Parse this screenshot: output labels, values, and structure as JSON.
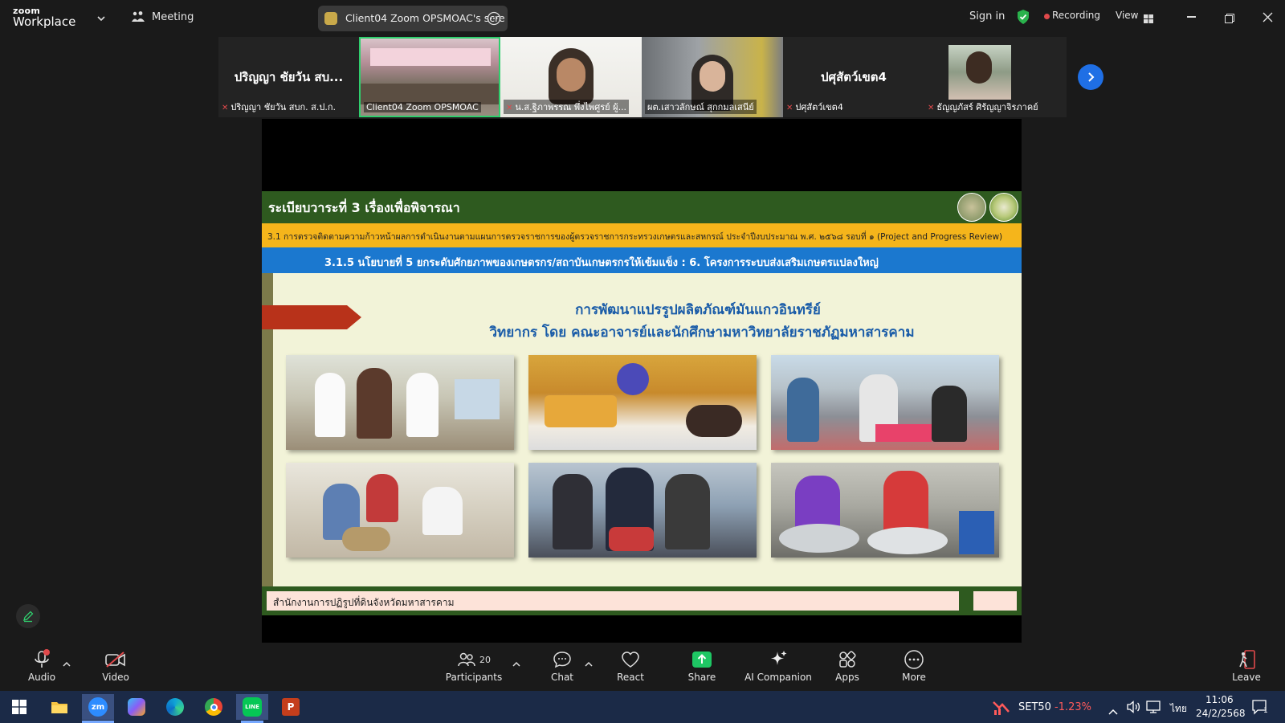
{
  "app": {
    "logo_top": "zoom",
    "logo_bottom": "Workplace",
    "meeting_label": "Meeting",
    "share_title": "Client04 Zoom OPSMOAC's scre",
    "sign_in": "Sign in",
    "recording": "Recording",
    "view": "View"
  },
  "participants_strip": [
    {
      "big_name": "ปริญญา ชัยวัน สบ...",
      "label": "ปริญญา ชัยวัน สบก. ส.ป.ก."
    },
    {
      "big_name": "",
      "label": "Client04 Zoom OPSMOAC"
    },
    {
      "big_name": "",
      "label": "น.ส.ฐิภาพรรณ พึ่งไพศูรย์ ผู้..."
    },
    {
      "big_name": "",
      "label": "ผต.เสาวลักษณ์ สุกกมลเสนีย์"
    },
    {
      "big_name": "ปศุสัตว์เขต4",
      "label": "ปศุสัตว์เขต4"
    },
    {
      "big_name": "",
      "label": "ธัญญภัสร์ ศิรัญญาจิรภาคย์"
    }
  ],
  "slide": {
    "title": "ระเบียบวาระที่ 3 เรื่องเพื่อพิจารณา",
    "yellow_bar": "3.1 การตรวจติดตามความก้าวหน้าผลการดำเนินงานตามแผนการตรวจราชการของผู้ตรวจราชการกระทรวงเกษตรและสหกรณ์ ประจำปีงบประมาณ พ.ศ. ๒๕๖๘ รอบที่ ๑ (Project and Progress Review)",
    "blue_bar": "3.1.5 นโยบายที่ 5 ยกระดับศักยภาพของเกษตรกร/สถาบันเกษตรกรให้เข้มแข็ง : 6. โครงการระบบส่งเสริมเกษตรแปลงใหญ่",
    "heading1": "การพัฒนาแปรรูปผลิตภัณฑ์มันแกวอินทรีย์",
    "heading2": "วิทยากร โดย คณะอาจารย์และนักศึกษามหาวิทยาลัยราชภัฏมหาสารคาม",
    "footer": "สำนักงานการปฏิรูปที่ดินจังหวัดมหาสารคาม"
  },
  "toolbar": {
    "audio": "Audio",
    "video": "Video",
    "participants": "Participants",
    "participants_count": "20",
    "chat": "Chat",
    "react": "React",
    "share": "Share",
    "ai_companion": "AI Companion",
    "apps": "Apps",
    "more": "More",
    "leave": "Leave"
  },
  "taskbar": {
    "stock_name": "SET50",
    "stock_change": "-1.23%",
    "language": "ไทย",
    "time": "11:06",
    "date": "24/2/2568",
    "notification_count": "1"
  },
  "colors": {
    "recording_dot": "#e0494b",
    "shield": "#2ab24c",
    "share_green": "#1ec764",
    "stock_red": "#ff5a5a",
    "active_tile": "#2fce6d"
  }
}
